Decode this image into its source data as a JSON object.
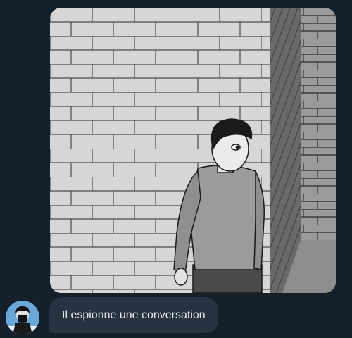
{
  "conversation": {
    "messages": [
      {
        "sender": "incoming",
        "type": "image",
        "image_description_icon": "comic-illustration"
      },
      {
        "sender": "incoming",
        "type": "text",
        "text": "Il espionne une conversation"
      }
    ]
  },
  "colors": {
    "background": "#15202b",
    "bubble": "#273340",
    "bubble_text": "#e7e9ea"
  }
}
